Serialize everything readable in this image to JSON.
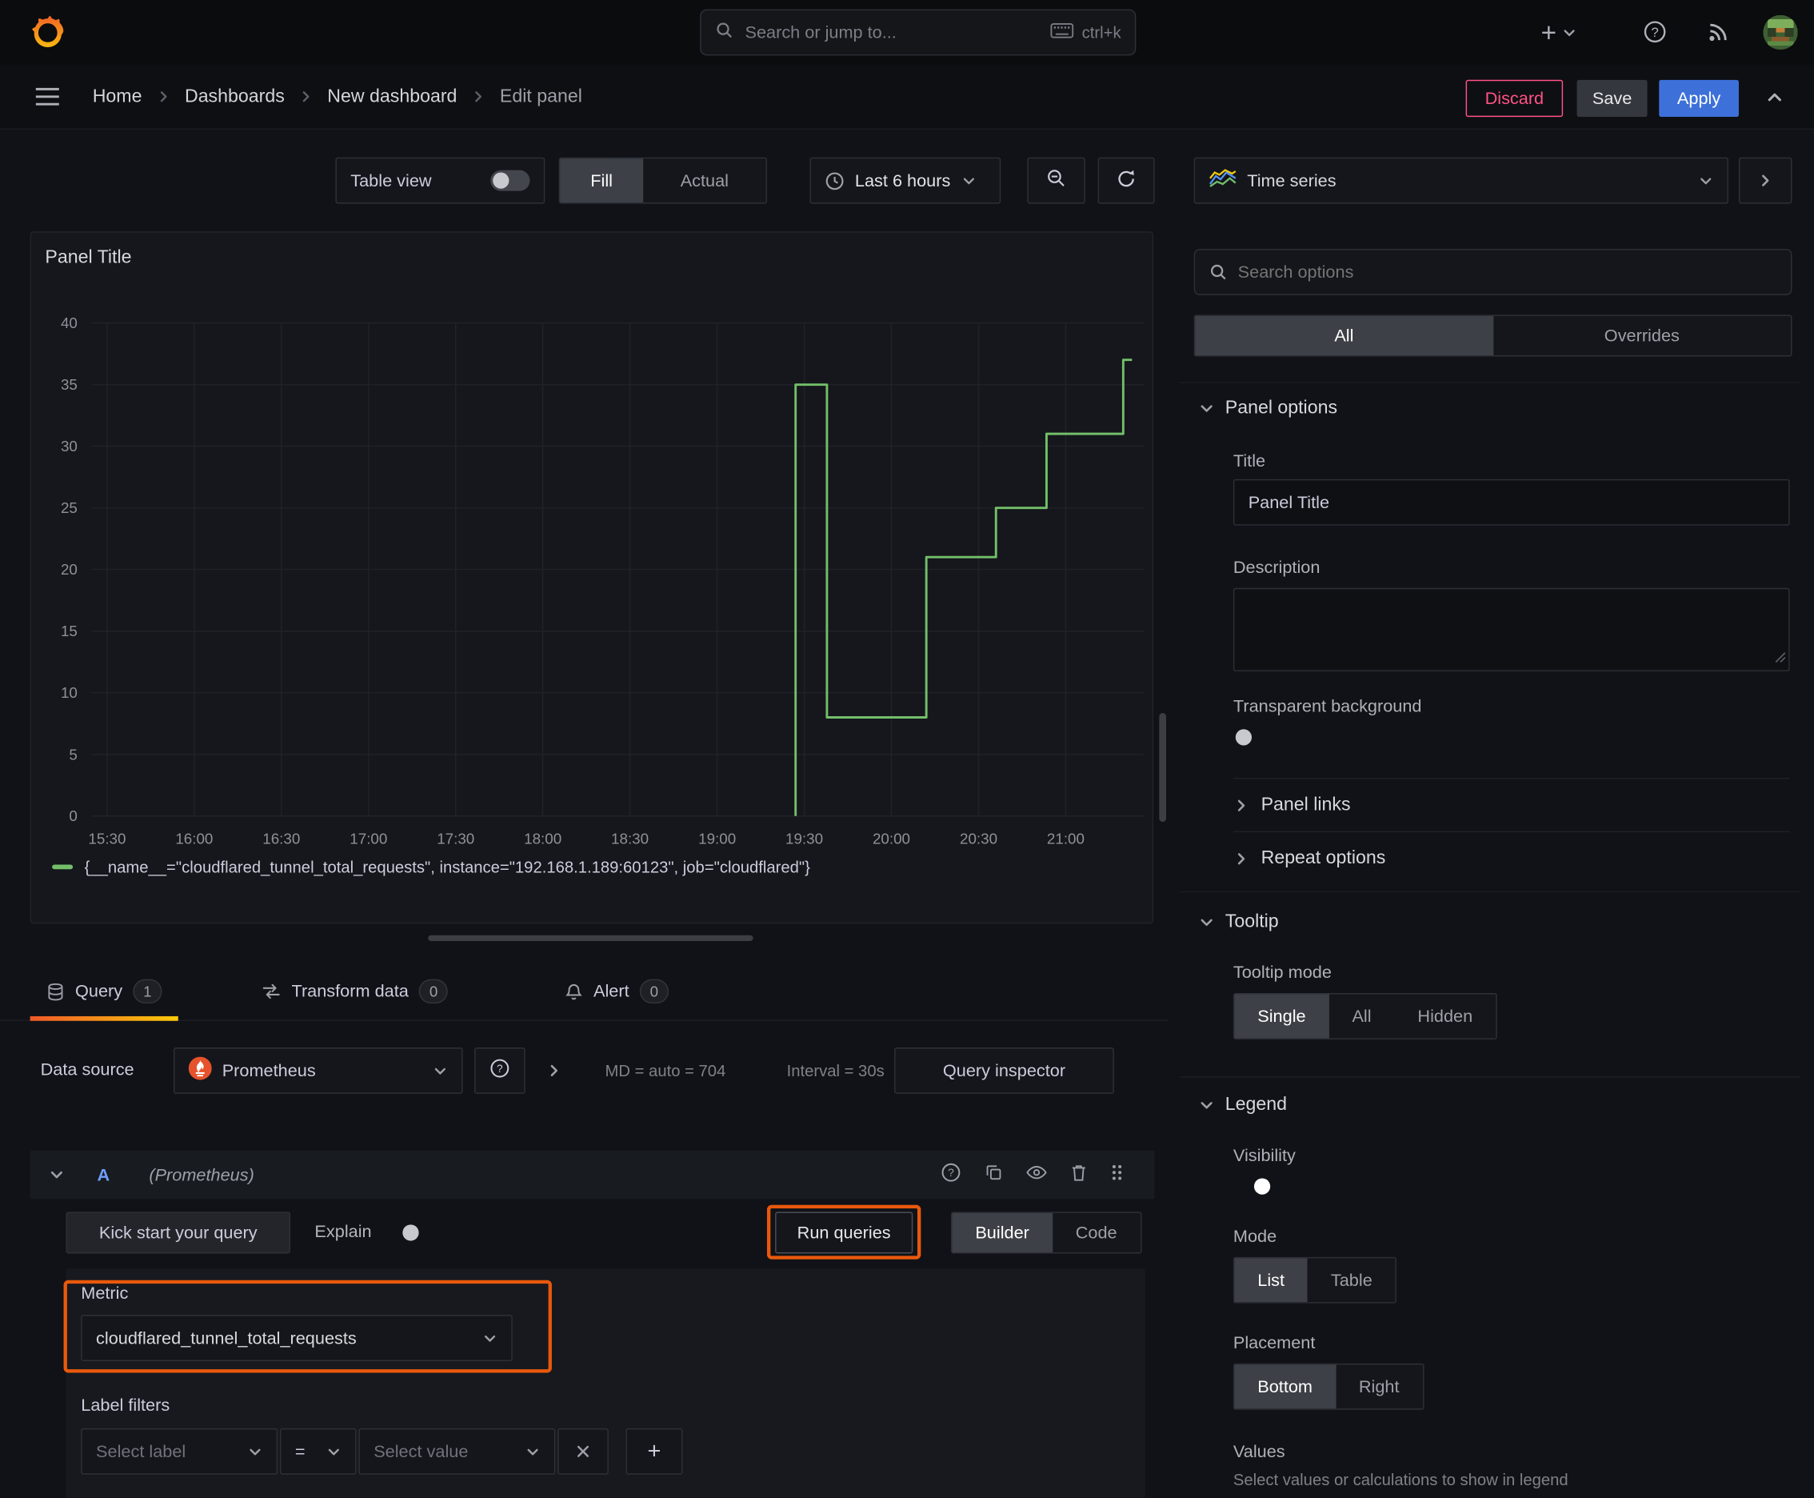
{
  "colors": {
    "accent_blue": "#3d71d9",
    "destructive_pink": "#ff5286",
    "series_green": "#73bf69",
    "tab_gradient_start": "#f05a28",
    "tab_gradient_end": "#fbca0a",
    "annotation_orange": "#e8590c"
  },
  "topbar": {
    "search_placeholder": "Search or jump to...",
    "search_shortcut": "ctrl+k"
  },
  "breadcrumb": {
    "items": [
      "Home",
      "Dashboards",
      "New dashboard",
      "Edit panel"
    ]
  },
  "header_actions": {
    "discard": "Discard",
    "save": "Save",
    "apply": "Apply"
  },
  "toolbar": {
    "table_view_label": "Table view",
    "fill_label": "Fill",
    "actual_label": "Actual",
    "time_range_label": "Last 6 hours"
  },
  "panel": {
    "title": "Panel Title",
    "legend_label": "{__name__=\"cloudflared_tunnel_total_requests\", instance=\"192.168.1.189:60123\", job=\"cloudflared\"}"
  },
  "chart_data": {
    "type": "line",
    "title": "Panel Title",
    "x_ticks": [
      "15:30",
      "16:00",
      "16:30",
      "17:00",
      "17:30",
      "18:00",
      "18:30",
      "19:00",
      "19:30",
      "20:00",
      "20:30",
      "21:00"
    ],
    "x_tick_hours": [
      15.5,
      16,
      16.5,
      17,
      17.5,
      18,
      18.5,
      19,
      19.5,
      20,
      20.5,
      21
    ],
    "x_range_hours": [
      15.41,
      21.45
    ],
    "y_ticks": [
      0,
      5,
      10,
      15,
      20,
      25,
      30,
      35,
      40
    ],
    "ylim": [
      0,
      40
    ],
    "grid": true,
    "legend_position": "bottom",
    "series": [
      {
        "name": "{__name__=\"cloudflared_tunnel_total_requests\", instance=\"192.168.1.189:60123\", job=\"cloudflared\"}",
        "color": "#73bf69",
        "step": true,
        "points_hour_value": [
          [
            19.45,
            0
          ],
          [
            19.45,
            35
          ],
          [
            19.63,
            35
          ],
          [
            19.63,
            8
          ],
          [
            20.2,
            8
          ],
          [
            20.2,
            21
          ],
          [
            20.6,
            21
          ],
          [
            20.6,
            25
          ],
          [
            20.89,
            25
          ],
          [
            20.89,
            31
          ],
          [
            21.33,
            31
          ],
          [
            21.33,
            37
          ],
          [
            21.38,
            37
          ]
        ]
      }
    ]
  },
  "tabs": {
    "query": {
      "label": "Query",
      "count": "1"
    },
    "transform": {
      "label": "Transform data",
      "count": "0"
    },
    "alert": {
      "label": "Alert",
      "count": "0"
    }
  },
  "query": {
    "datasource_label": "Data source",
    "datasource_name": "Prometheus",
    "max_data_points": "MD = auto = 704",
    "interval": "Interval = 30s",
    "query_inspector": "Query inspector",
    "row_letter": "A",
    "row_datasource": "(Prometheus)",
    "kick_start": "Kick start your query",
    "explain": "Explain",
    "run_queries": "Run queries",
    "builder": "Builder",
    "code": "Code",
    "metric_label": "Metric",
    "metric_value": "cloudflared_tunnel_total_requests",
    "label_filters_label": "Label filters",
    "select_label_placeholder": "Select label",
    "operator": "=",
    "select_value_placeholder": "Select value"
  },
  "options_pane": {
    "visualization": "Time series",
    "search_placeholder": "Search options",
    "tab_all": "All",
    "tab_overrides": "Overrides",
    "panel_options": {
      "heading": "Panel options",
      "title_label": "Title",
      "title_value": "Panel Title",
      "description_label": "Description",
      "transparent_label": "Transparent background",
      "panel_links": "Panel links",
      "repeat_options": "Repeat options"
    },
    "tooltip": {
      "heading": "Tooltip",
      "mode_label": "Tooltip mode",
      "single": "Single",
      "all": "All",
      "hidden": "Hidden"
    },
    "legend": {
      "heading": "Legend",
      "visibility_label": "Visibility",
      "mode_label": "Mode",
      "list": "List",
      "table": "Table",
      "placement_label": "Placement",
      "bottom": "Bottom",
      "right": "Right",
      "values_label": "Values",
      "values_help": "Select values or calculations to show in legend"
    }
  },
  "icons": {
    "grafana-logo": "grafana-flame",
    "search-icon": "magnifier",
    "keyboard-icon": "keyboard",
    "add-icon": "+",
    "chevron-down-icon": "v",
    "chevron-right-icon": ">",
    "chevron-up-icon": "^",
    "help-icon": "?",
    "news-icon": "rss-arcs",
    "menu-icon": "hamburger",
    "clock-icon": "clock",
    "zoom-out-icon": "magnifier-minus",
    "refresh-icon": "circular-arrow",
    "database-icon": "db-cylinder",
    "transform-icon": "exchange-arrows",
    "bell-icon": "bell",
    "prometheus-icon": "prometheus-torch",
    "copy-icon": "two-pages",
    "eye-icon": "eye",
    "trash-icon": "trash-can",
    "drag-handle-icon": "grip-dots",
    "close-icon": "x",
    "plus-icon": "+",
    "timeseries-icon": "mini-line-chart",
    "user-avatar": "pixel-avatar"
  }
}
